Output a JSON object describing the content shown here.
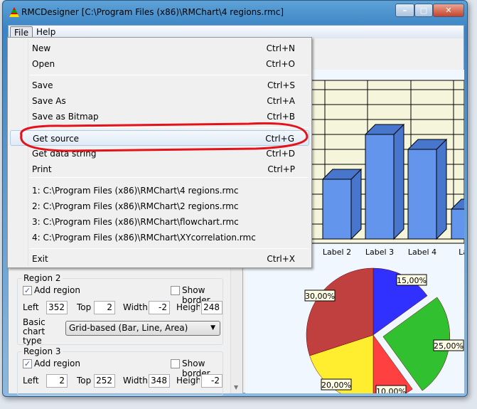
{
  "window": {
    "title": "RMCDesigner  [C:\\Program Files (x86)\\RMChart\\4 regions.rmc]",
    "minimize": "minimize",
    "maximize": "maximize",
    "close": "close"
  },
  "menubar": {
    "file": "File",
    "help": "Help"
  },
  "file_menu": {
    "items": [
      {
        "label": "New",
        "shortcut": "Ctrl+N"
      },
      {
        "label": "Open",
        "shortcut": "Ctrl+O"
      },
      {
        "label": "Save",
        "shortcut": "Ctrl+S"
      },
      {
        "label": "Save As",
        "shortcut": "Ctrl+A"
      },
      {
        "label": "Save as Bitmap",
        "shortcut": "Ctrl+B"
      },
      {
        "label": "Get source",
        "shortcut": "Ctrl+G",
        "highlighted": true
      },
      {
        "label": "Get data string",
        "shortcut": "Ctrl+D"
      },
      {
        "label": "Print",
        "shortcut": "Ctrl+P"
      },
      {
        "label": "1: C:\\Program Files (x86)\\RMChart\\4 regions.rmc"
      },
      {
        "label": "2: C:\\Program Files (x86)\\RMChart\\2 regions.rmc"
      },
      {
        "label": "3: C:\\Program Files (x86)\\RMChart\\flowchart.rmc"
      },
      {
        "label": "4: C:\\Program Files (x86)\\RMChart\\XYcorrelation.rmc"
      },
      {
        "label": "Exit",
        "shortcut": "Ctrl+X"
      }
    ]
  },
  "regions": [
    {
      "title": "Region 2",
      "add_region": "Add region",
      "add_checked": true,
      "show_border": "Show border",
      "border_checked": false,
      "left_label": "Left",
      "left": "352",
      "top_label": "Top",
      "top": "2",
      "width_label": "Width",
      "width": "-2",
      "height_label": "Height",
      "height": "248",
      "chart_type_label": "Basic chart type",
      "chart_type": "Grid-based (Bar, Line, Area)"
    },
    {
      "title": "Region 3",
      "add_region": "Add region",
      "add_checked": true,
      "show_border": "Show border",
      "border_checked": false,
      "left_label": "Left",
      "left": "2",
      "top_label": "Top",
      "top": "252",
      "width_label": "Width",
      "width": "348",
      "height_label": "Height",
      "height": "-2"
    }
  ],
  "chart_data": [
    {
      "type": "bar",
      "categories": [
        "Label 2",
        "Label 3",
        "Label 4",
        "Lab"
      ],
      "values": [
        4,
        7,
        6,
        2
      ],
      "grid": true,
      "colors": {
        "front": "#6495ed",
        "side": "#4876cc",
        "background": "#f5f5dc"
      }
    },
    {
      "type": "pie",
      "labels": [
        "15,00%",
        "25,00%",
        "10,00%",
        "20,00%",
        "30,00%"
      ],
      "values": [
        15,
        25,
        10,
        20,
        30
      ],
      "colors": [
        "#3030ff",
        "#30c030",
        "#ff4040",
        "#ffee30",
        "#c04040"
      ]
    }
  ]
}
